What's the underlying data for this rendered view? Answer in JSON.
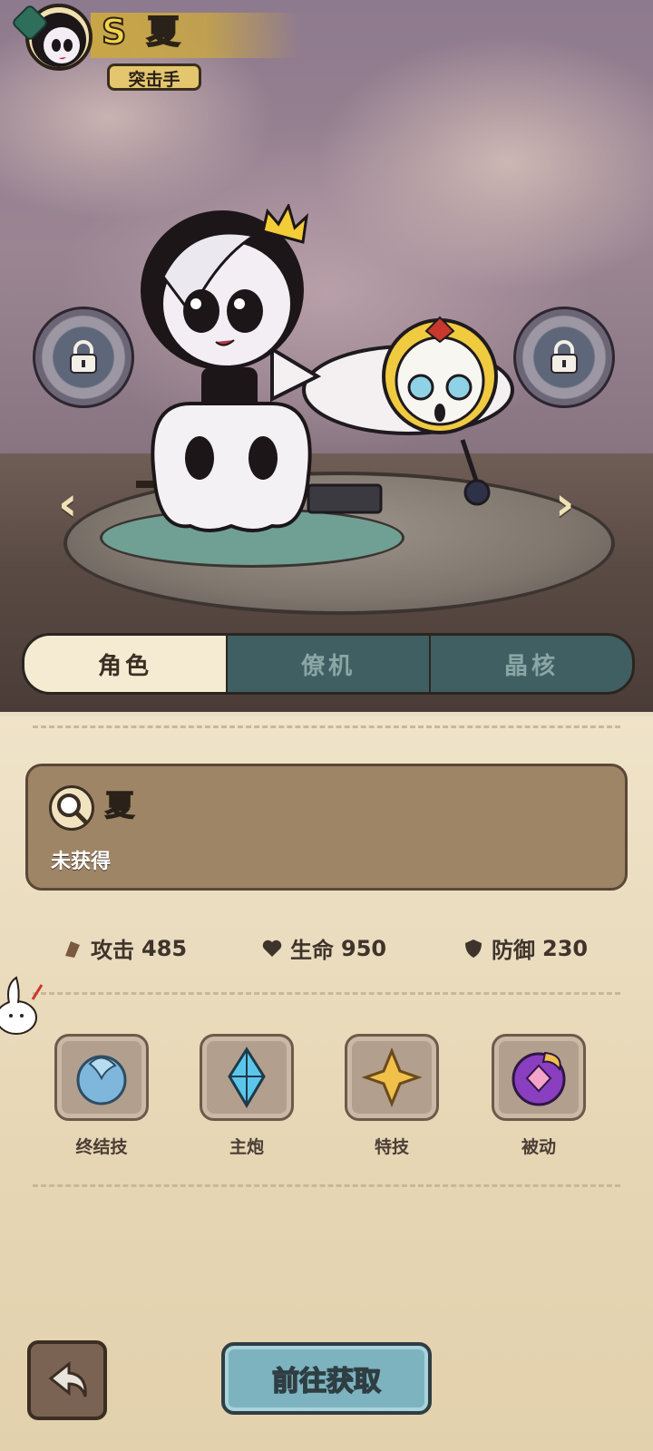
{
  "header": {
    "rank": "S",
    "name": "夏",
    "role": "突击手"
  },
  "tabs": [
    {
      "label": "角色",
      "active": true
    },
    {
      "label": "僚机",
      "active": false
    },
    {
      "label": "晶核",
      "active": false
    }
  ],
  "info": {
    "name": "夏",
    "status": "未获得"
  },
  "stats": [
    {
      "icon": "attack-icon",
      "label": "攻击",
      "value": "485"
    },
    {
      "icon": "heart-icon",
      "label": "生命",
      "value": "950"
    },
    {
      "icon": "shield-icon",
      "label": "防御",
      "value": "230"
    }
  ],
  "skills": [
    {
      "icon": "finisher-skill-icon",
      "label": "终结技"
    },
    {
      "icon": "main-cannon-icon",
      "label": "主炮"
    },
    {
      "icon": "special-skill-icon",
      "label": "特技"
    },
    {
      "icon": "passive-skill-icon",
      "label": "被动"
    }
  ],
  "actions": {
    "go_obtain": "前往获取"
  },
  "colors": {
    "accent_gold": "#c8a646",
    "tab_active": "#f5ebd3",
    "tab_inactive": "#3f5f62",
    "button_blue": "#7cb3bf"
  }
}
